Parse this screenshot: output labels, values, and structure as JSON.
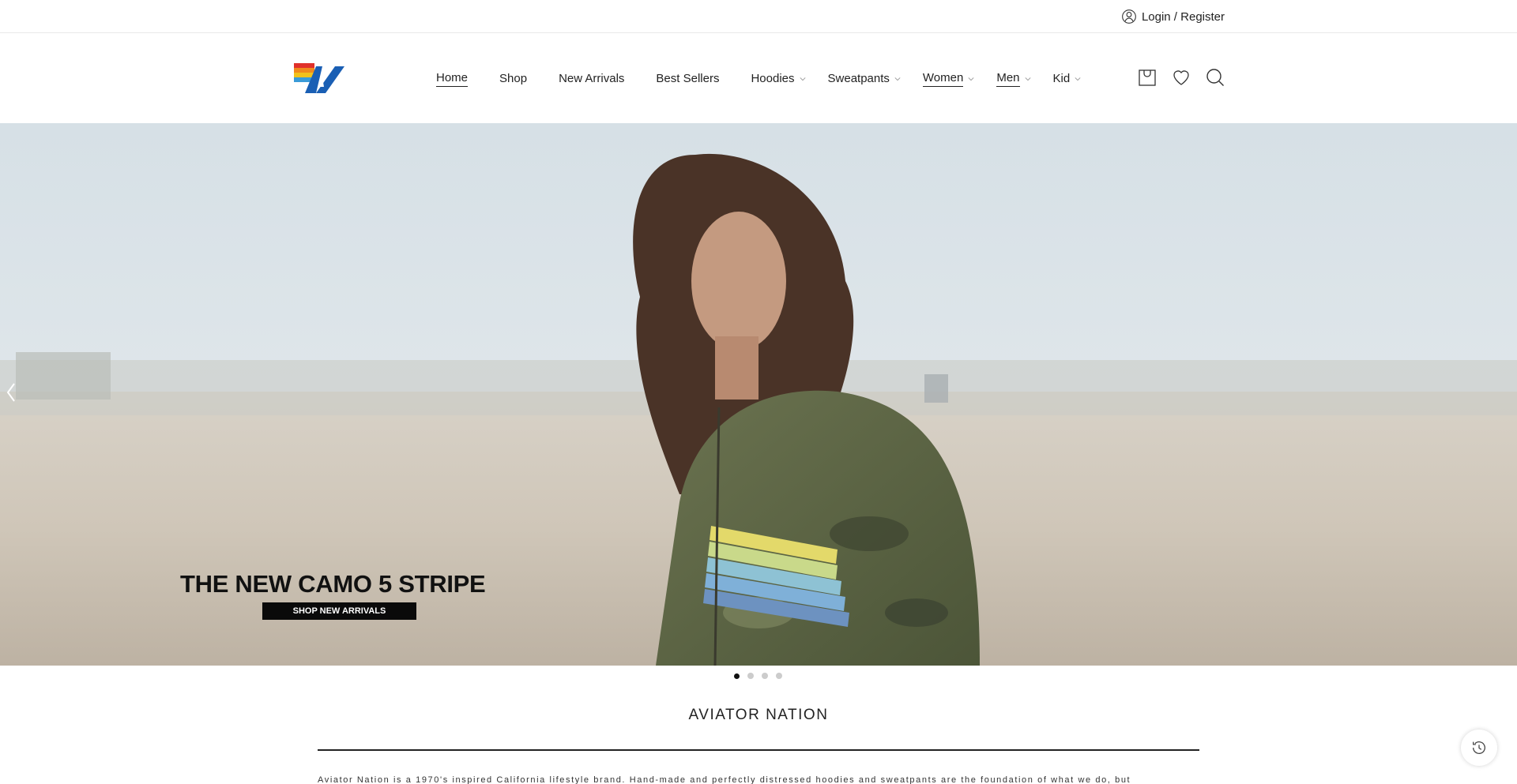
{
  "topbar": {
    "login_label": "Login / Register"
  },
  "header": {
    "nav": [
      {
        "label": "Home",
        "underline": true,
        "dropdown": false
      },
      {
        "label": "Shop",
        "underline": false,
        "dropdown": false
      },
      {
        "label": "New Arrivals",
        "underline": false,
        "dropdown": false
      },
      {
        "label": "Best Sellers",
        "underline": false,
        "dropdown": false
      },
      {
        "label": "Hoodies",
        "underline": false,
        "dropdown": true
      },
      {
        "label": "Sweatpants",
        "underline": false,
        "dropdown": true
      },
      {
        "label": "Women",
        "underline": true,
        "dropdown": true
      },
      {
        "label": "Men",
        "underline": true,
        "dropdown": true
      },
      {
        "label": "Kid",
        "underline": false,
        "dropdown": true
      }
    ],
    "icons": [
      "cart-icon",
      "wishlist-heart-icon",
      "search-icon"
    ]
  },
  "hero": {
    "title": "THE NEW CAMO 5 STRIPE",
    "button_label": "SHOP NEW ARRIVALS",
    "slide_count": 4,
    "active_slide": 1
  },
  "about": {
    "title": "AVIATOR NATION",
    "text": "Aviator Nation is a 1970's inspired California lifestyle brand. Hand-made and perfectly distressed hoodies and sweatpants are the foundation of what we do, but"
  },
  "colors": {
    "accent_dark": "#0a0a0a",
    "logo_blue": "#1a5fb4",
    "logo_red": "#e0302a",
    "logo_yellow": "#f2c21b"
  }
}
